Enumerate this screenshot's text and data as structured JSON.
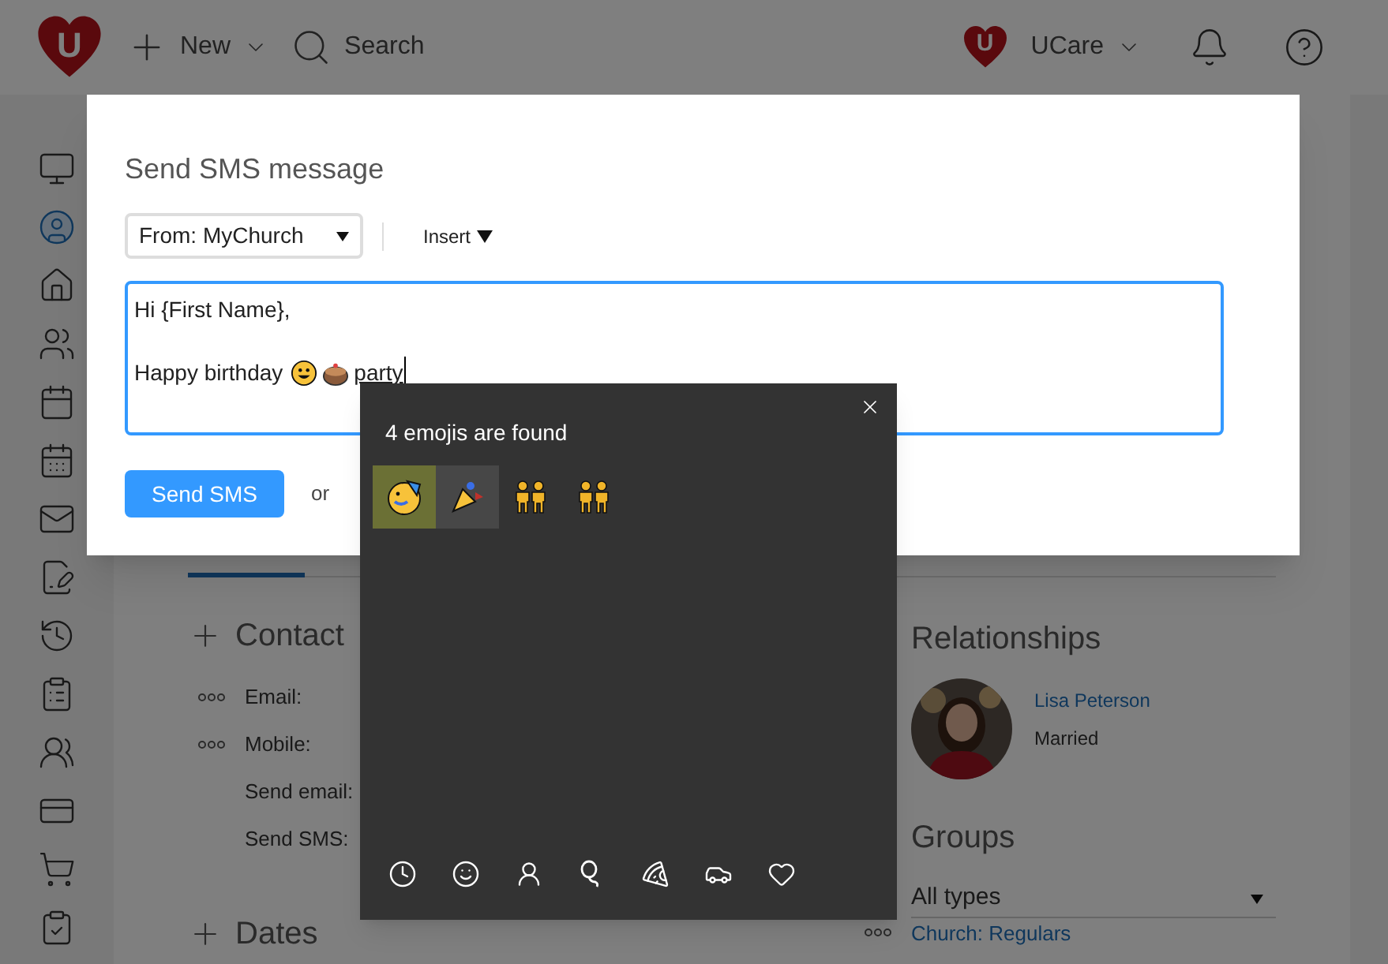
{
  "topbar": {
    "logo": "U",
    "new_label": "New",
    "search_label": "Search",
    "account_logo": "U",
    "account_name": "UCare"
  },
  "sidebar": {
    "items": [
      {
        "kind": "monitor",
        "selected": false
      },
      {
        "kind": "person",
        "selected": true
      },
      {
        "kind": "home",
        "selected": false
      },
      {
        "kind": "people",
        "selected": false
      },
      {
        "kind": "calendar",
        "selected": false
      },
      {
        "kind": "calendar-day",
        "selected": false
      },
      {
        "kind": "mail",
        "selected": false
      },
      {
        "kind": "form",
        "selected": false
      },
      {
        "kind": "history",
        "selected": false
      },
      {
        "kind": "clipboard",
        "selected": false
      },
      {
        "kind": "group",
        "selected": false
      },
      {
        "kind": "card",
        "selected": false
      },
      {
        "kind": "cart",
        "selected": false
      },
      {
        "kind": "checklist",
        "selected": false
      }
    ]
  },
  "profile": {
    "contact_heading": "Contact",
    "fields": [
      {
        "label": "Email:",
        "menu": true
      },
      {
        "label": "Mobile:",
        "menu": true
      },
      {
        "label": "Send email:",
        "menu": false
      },
      {
        "label": "Send SMS:",
        "menu": false
      }
    ],
    "dates_heading": "Dates",
    "relationships_heading": "Relationships",
    "relationship": {
      "name": "Lisa Peterson",
      "status": "Married"
    },
    "groups_heading": "Groups",
    "group_filter": "All types",
    "groups": [
      {
        "name": "Church: Regulars"
      }
    ]
  },
  "dialog": {
    "title": "Send SMS message",
    "from": "From: MyChurch",
    "insert": "Insert",
    "message": {
      "line1": "Hi {First Name},",
      "line2": "Happy birthday",
      "typed": "party"
    },
    "send_button": "Send SMS",
    "or": "or"
  },
  "emoji_panel": {
    "title": "4 emojis are found",
    "results": [
      {
        "kind": "party-face",
        "selected": true,
        "hovered": false
      },
      {
        "kind": "party-popper",
        "selected": false,
        "hovered": true
      },
      {
        "kind": "people",
        "selected": false,
        "hovered": false
      },
      {
        "kind": "people",
        "selected": false,
        "hovered": false
      }
    ],
    "categories": [
      {
        "kind": "recent"
      },
      {
        "kind": "smiley"
      },
      {
        "kind": "person"
      },
      {
        "kind": "balloon"
      },
      {
        "kind": "food"
      },
      {
        "kind": "travel"
      },
      {
        "kind": "heart"
      }
    ]
  }
}
